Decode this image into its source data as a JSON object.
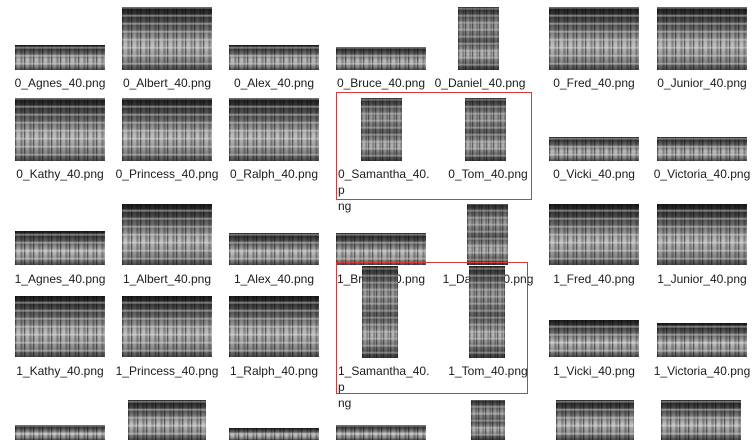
{
  "accent_selection_color": "#d9383a",
  "files": {
    "r0": [
      "0_Agnes_40.png",
      "0_Albert_40.png",
      "0_Alex_40.png",
      "0_Bruce_40.png",
      "0_Daniel_40.png",
      "0_Fred_40.png",
      "0_Junior_40.png"
    ],
    "r1": [
      "0_Kathy_40.png",
      "0_Princess_40.png",
      "0_Ralph_40.png",
      "0_Samantha_40.png",
      "0_Tom_40.png",
      "0_Vicki_40.png",
      "0_Victoria_40.png"
    ],
    "r2": [
      "1_Agnes_40.png",
      "1_Albert_40.png",
      "1_Alex_40.png",
      "1_Bruce_40.png",
      "1_Daniel_40.png",
      "1_Fred_40.png",
      "1_Junior_40.png"
    ],
    "r3": [
      "1_Kathy_40.png",
      "1_Princess_40.png",
      "1_Ralph_40.png",
      "1_Samantha_40.png",
      "1_Tom_40.png",
      "1_Vicki_40.png",
      "1_Victoria_40.png"
    ]
  },
  "princess_split": [
    "0_Princess_40.pn",
    "g",
    "1_Princess_40.pn",
    "g"
  ],
  "samantha_split": [
    "0_Samantha_40.p",
    "ng",
    "1_Samantha_40.p",
    "ng"
  ]
}
